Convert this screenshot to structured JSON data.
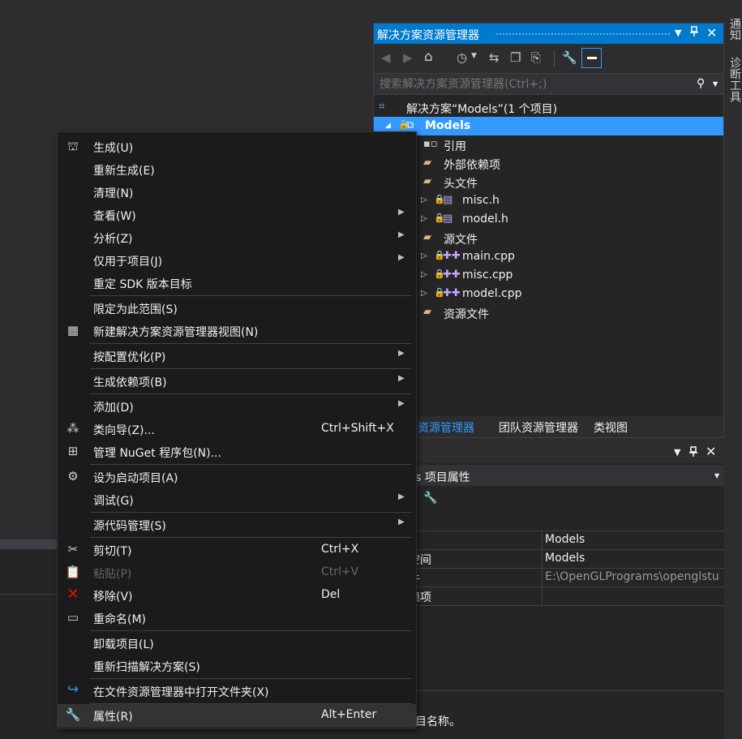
{
  "solution_explorer": {
    "title": "解决方案资源管理器",
    "search_placeholder": "搜索解决方案资源管理器(Ctrl+;)",
    "tree": [
      {
        "label": "解决方案“Models”(1 个项目)",
        "icon": "solution-icon"
      },
      {
        "label": "Models",
        "icon": "project-icon",
        "selected": true
      },
      {
        "label": "引用",
        "icon": "references-icon"
      },
      {
        "label": "外部依赖项",
        "icon": "external-deps-icon"
      },
      {
        "label": "头文件",
        "icon": "folder-icon"
      },
      {
        "label": "misc.h",
        "icon": "header-file-icon"
      },
      {
        "label": "model.h",
        "icon": "header-file-icon"
      },
      {
        "label": "源文件",
        "icon": "folder-icon"
      },
      {
        "label": "main.cpp",
        "icon": "cpp-file-icon"
      },
      {
        "label": "misc.cpp",
        "icon": "cpp-file-icon"
      },
      {
        "label": "model.cpp",
        "icon": "cpp-file-icon"
      },
      {
        "label": "资源文件",
        "icon": "folder-icon"
      }
    ],
    "bottom_tabs": [
      "案资源管理器",
      "团队资源管理器",
      "类视图"
    ]
  },
  "right_tabs": [
    "通知",
    "诊断工具"
  ],
  "properties": {
    "header": "s 项目属性",
    "rows": [
      {
        "key": "()",
        "value": "Models"
      },
      {
        "key": "名空间",
        "value": "Models"
      },
      {
        "key": "文件",
        "value": "E:\\OpenGLPrograms\\openglstu"
      },
      {
        "key": "依赖项",
        "value": ""
      }
    ],
    "description": "目名称。"
  },
  "context_menu": {
    "items": [
      {
        "label": "生成(U)",
        "icon": "build-icon"
      },
      {
        "label": "重新生成(E)"
      },
      {
        "label": "清理(N)"
      },
      {
        "label": "查看(W)",
        "submenu": true
      },
      {
        "label": "分析(Z)",
        "submenu": true
      },
      {
        "label": "仅用于项目(J)",
        "submenu": true
      },
      {
        "label": "重定 SDK 版本目标"
      },
      {
        "label": "限定为此范围(S)"
      },
      {
        "label": "新建解决方案资源管理器视图(N)",
        "icon": "new-view-icon"
      },
      {
        "label": "按配置优化(P)",
        "submenu": true
      },
      {
        "label": "生成依赖项(B)",
        "submenu": true
      },
      {
        "label": "添加(D)",
        "submenu": true
      },
      {
        "label": "类向导(Z)...",
        "shortcut": "Ctrl+Shift+X",
        "icon": "class-wizard-icon"
      },
      {
        "label": "管理 NuGet 程序包(N)...",
        "icon": "nuget-icon"
      },
      {
        "label": "设为启动项目(A)",
        "icon": "gear-icon"
      },
      {
        "label": "调试(G)",
        "submenu": true
      },
      {
        "label": "源代码管理(S)",
        "submenu": true
      },
      {
        "label": "剪切(T)",
        "shortcut": "Ctrl+X",
        "icon": "scissors-icon"
      },
      {
        "label": "粘贴(P)",
        "shortcut": "Ctrl+V",
        "icon": "paste-icon",
        "disabled": true
      },
      {
        "label": "移除(V)",
        "shortcut": "Del",
        "icon": "remove-icon"
      },
      {
        "label": "重命名(M)",
        "icon": "rename-icon"
      },
      {
        "label": "卸载项目(L)"
      },
      {
        "label": "重新扫描解决方案(S)"
      },
      {
        "label": "在文件资源管理器中打开文件夹(X)",
        "icon": "open-folder-arrow-icon"
      },
      {
        "label": "属性(R)",
        "shortcut": "Alt+Enter",
        "icon": "wrench-icon",
        "highlighted": true
      }
    ]
  },
  "colors": {
    "accent": "#007acc",
    "menu_bg": "#1b1b1c",
    "panel_bg": "#252526",
    "remove_red": "#e51400",
    "open_blue": "#3794e6"
  }
}
